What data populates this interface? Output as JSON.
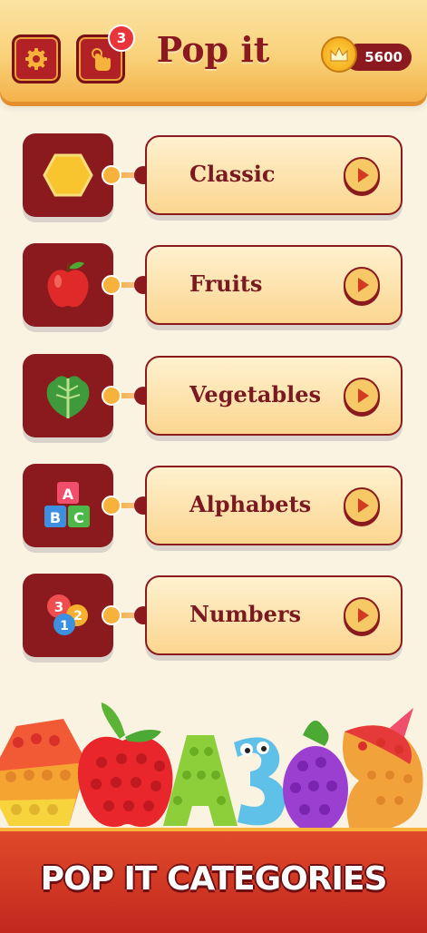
{
  "header": {
    "title": "Pop it",
    "hint_badge_count": "3",
    "coin_balance": "5600",
    "icons": {
      "settings": "gear-icon",
      "hint": "tap-hand-icon",
      "coin": "crown-coin-icon"
    }
  },
  "categories": [
    {
      "label": "Classic",
      "icon": "hexagon-icon"
    },
    {
      "label": "Fruits",
      "icon": "apple-icon"
    },
    {
      "label": "Vegetables",
      "icon": "lettuce-icon"
    },
    {
      "label": "Alphabets",
      "icon": "abc-blocks-icon"
    },
    {
      "label": "Numbers",
      "icon": "number-bubbles-icon"
    }
  ],
  "footer": {
    "banner": "POP IT CATEGORIES"
  },
  "colors": {
    "accent": "#8b1a1f",
    "card": "#fbd690",
    "coin": "#f5b020",
    "banner": "#d4361f"
  }
}
